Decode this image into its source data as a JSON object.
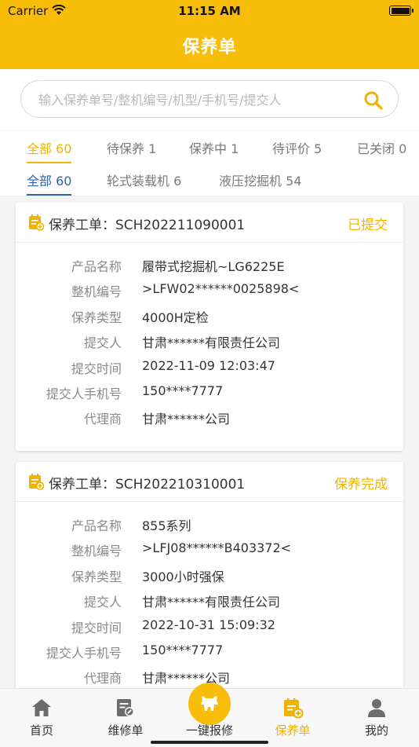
{
  "status": {
    "carrier": "Carrier",
    "time": "11:15 AM"
  },
  "header": {
    "title": "保养单"
  },
  "search": {
    "placeholder": "输入保养单号/整机编号/机型/手机号/提交人"
  },
  "status_tabs": [
    {
      "label": "全部 60",
      "active": true
    },
    {
      "label": "待保养 1"
    },
    {
      "label": "保养中 1"
    },
    {
      "label": "待评价 5"
    },
    {
      "label": "已关闭 0"
    }
  ],
  "type_tabs": [
    {
      "label": "全部 60",
      "active": true
    },
    {
      "label": "轮式装载机 6"
    },
    {
      "label": "液压挖掘机 54"
    }
  ],
  "orders": [
    {
      "title": "保养工单：SCH202211090001",
      "status": "已提交",
      "fields": [
        {
          "label": "产品名称",
          "value": "履带式挖掘机~LG6225E"
        },
        {
          "label": "整机编号",
          "value": ">LFW02******0025898<"
        },
        {
          "label": "保养类型",
          "value": "4000H定检"
        },
        {
          "label": "提交人",
          "value": "甘肃******有限责任公司"
        },
        {
          "label": "提交时间",
          "value": "2022-11-09 12:03:47"
        },
        {
          "label": "提交人手机号",
          "value": "150****7777"
        },
        {
          "label": "代理商",
          "value": "甘肃******公司"
        }
      ]
    },
    {
      "title": "保养工单：SCH202210310001",
      "status": "保养完成",
      "fields": [
        {
          "label": "产品名称",
          "value": "855系列"
        },
        {
          "label": "整机编号",
          "value": ">LFJ08******B403372<"
        },
        {
          "label": "保养类型",
          "value": "3000小时强保"
        },
        {
          "label": "提交人",
          "value": "甘肃******有限责任公司"
        },
        {
          "label": "提交时间",
          "value": "2022-10-31 15:09:32"
        },
        {
          "label": "提交人手机号",
          "value": "150****7777"
        },
        {
          "label": "代理商",
          "value": "甘肃******公司"
        }
      ]
    }
  ],
  "tabbar": [
    {
      "label": "首页",
      "icon": "home-icon"
    },
    {
      "label": "维修单",
      "icon": "repair-order-icon"
    },
    {
      "label": "一键报修",
      "icon": "quick-report-icon"
    },
    {
      "label": "保养单",
      "icon": "maintenance-order-icon",
      "active": true
    },
    {
      "label": "我的",
      "icon": "profile-icon"
    }
  ],
  "colors": {
    "brand": "#f8bd09",
    "accent": "#f0b400",
    "link": "#2d62b0"
  }
}
